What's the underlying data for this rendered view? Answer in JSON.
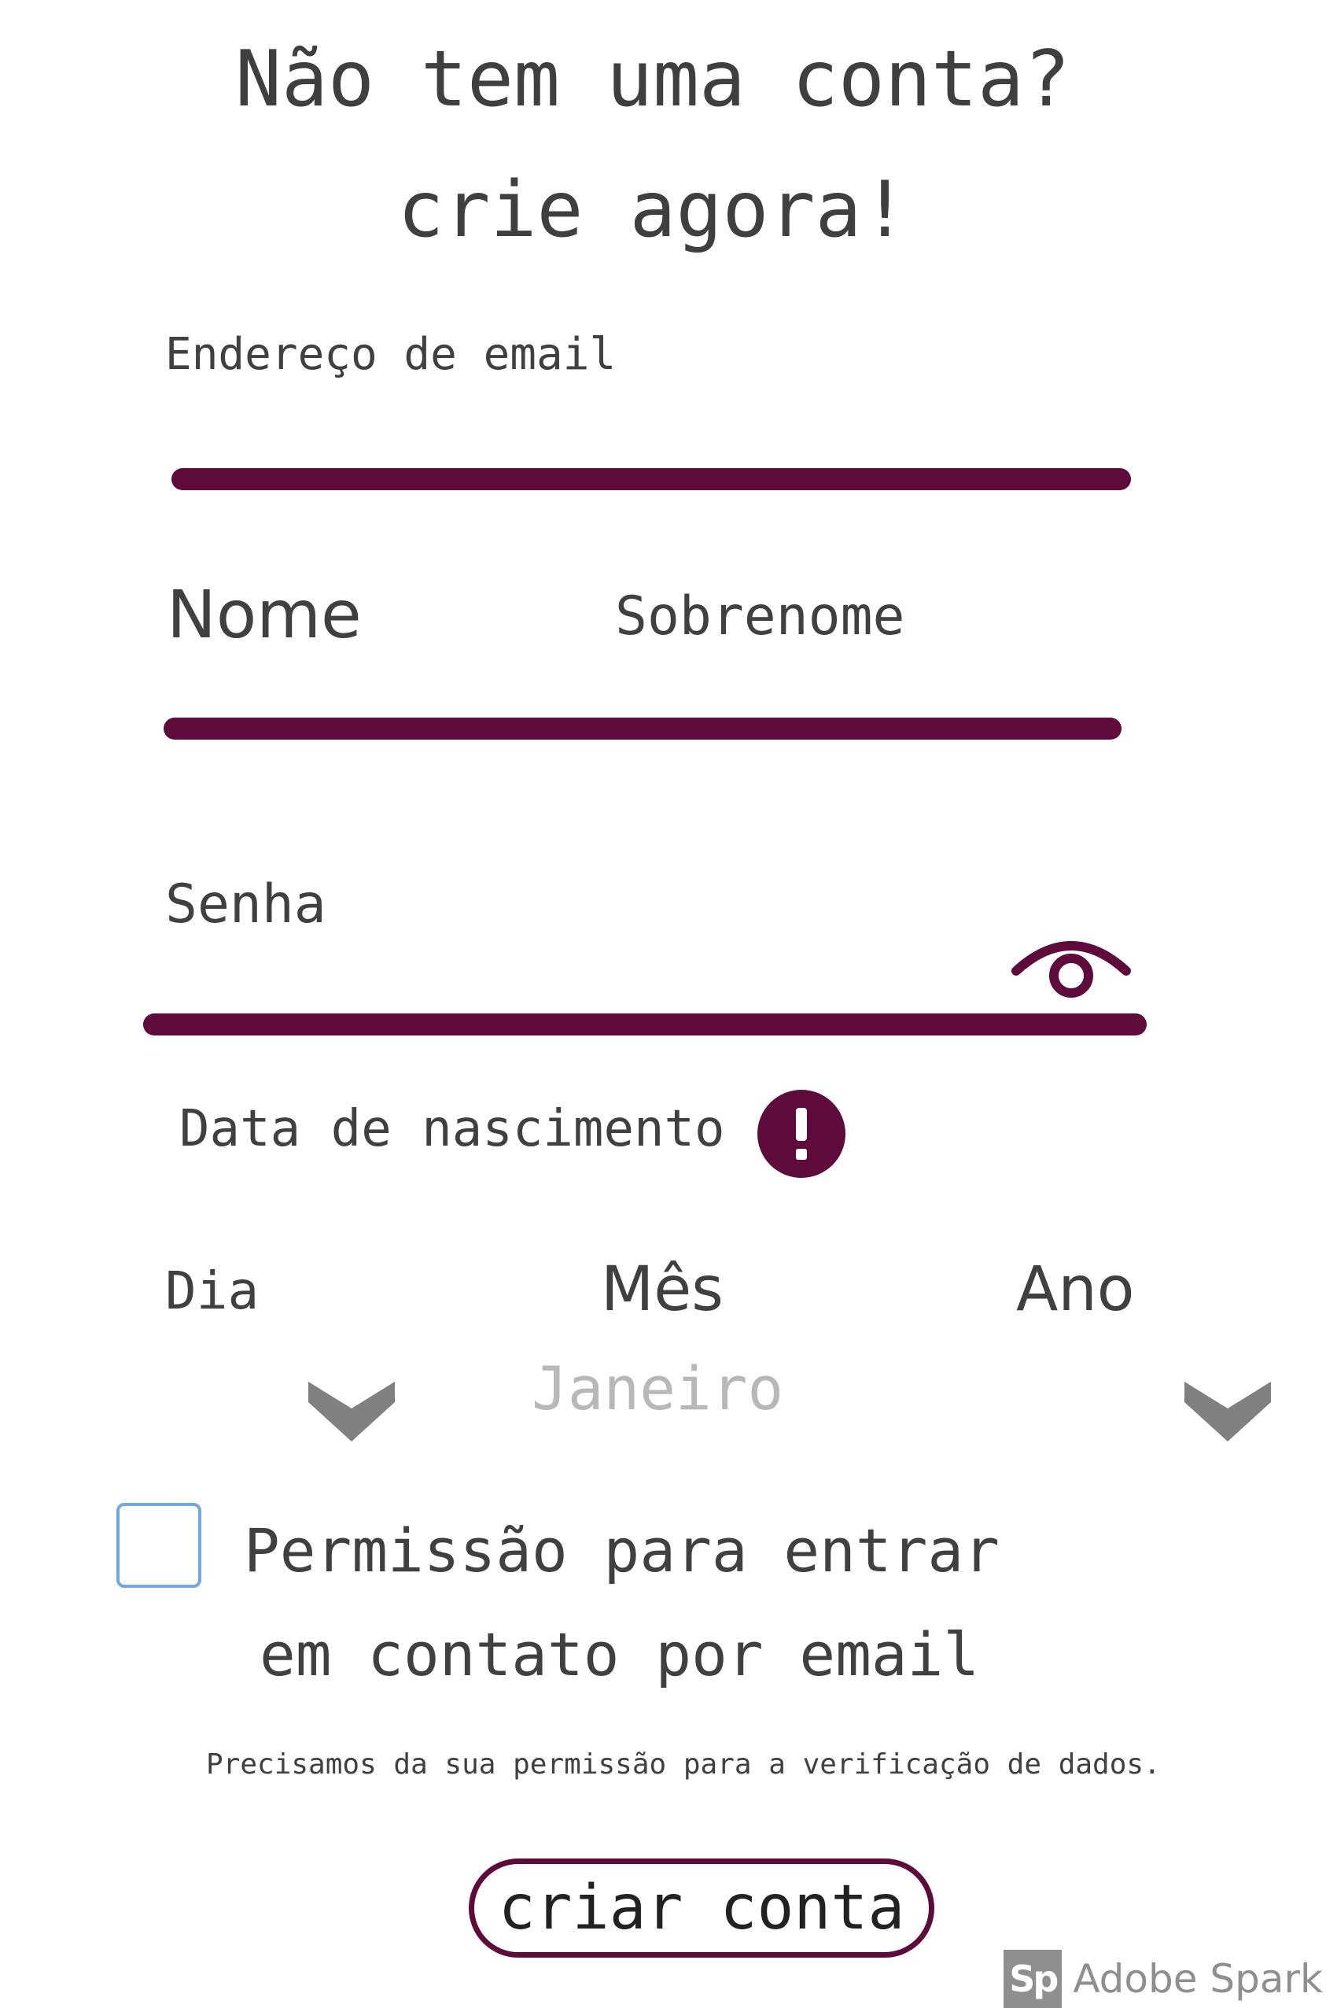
{
  "header": {
    "line1": "Não tem uma conta?",
    "line2": "crie agora!"
  },
  "email": {
    "label": "Endereço de email",
    "value": ""
  },
  "name": {
    "first_label": "Nome",
    "last_label": "Sobrenome",
    "first_value": "",
    "last_value": ""
  },
  "password": {
    "label": "Senha",
    "value": ""
  },
  "birthdate": {
    "label": "Data de nascimento",
    "day_label": "Dia",
    "month_label": "Mês",
    "year_label": "Ano",
    "month_value": "Janeiro"
  },
  "consent": {
    "line1": "Permissão para entrar",
    "line2": "em contato por email",
    "note": "Precisamos da sua permissão para a verificação de dados."
  },
  "submit": {
    "label": "criar conta"
  },
  "watermark": {
    "logo": "Sp",
    "text": "Adobe Spark"
  },
  "icons": {
    "eye": "eye-icon",
    "alert": "alert-icon",
    "chevron": "chevron-down-icon",
    "checkbox": "checkbox"
  },
  "colors": {
    "accent": "#5e0a3a",
    "text": "#3f3f3f",
    "placeholder": "#b8b8b8",
    "chevron": "#808080",
    "checkbox_border": "#74a6e6",
    "watermark": "#8f8f8f"
  }
}
